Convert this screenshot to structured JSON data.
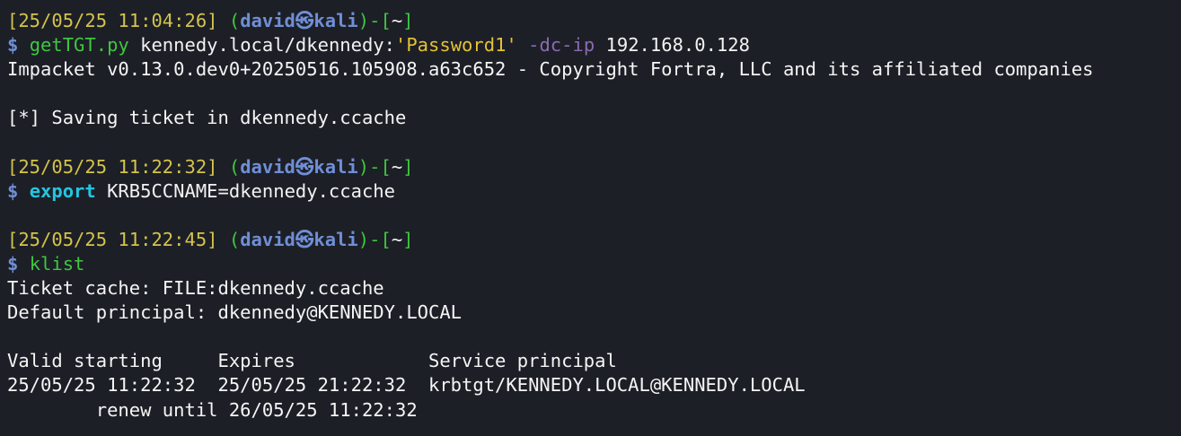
{
  "colors": {
    "background": "#1d1f27",
    "text": "#f2f2f2",
    "timestamp": "#d4c44a",
    "bracket": "#3ec73e",
    "user_host": "#6f8fd6",
    "command": "#3ec73e",
    "builtin": "#23c6e0",
    "string": "#e5c233",
    "option": "#8a6bb0"
  },
  "prompts": [
    {
      "timestamp": "[25/05/25 11:04:26]",
      "user": "david",
      "at_symbol": "㉿",
      "host": "kali",
      "dir": "~",
      "dollar": "$",
      "command": "getTGT.py",
      "arg1": "kennedy.local/dkennedy:",
      "arg_string": "'Password1'",
      "option": "-dc-ip",
      "arg2": "192.168.0.128"
    },
    {
      "timestamp": "[25/05/25 11:22:32]",
      "user": "david",
      "at_symbol": "㉿",
      "host": "kali",
      "dir": "~",
      "dollar": "$",
      "command": "export",
      "arg1": "KRB5CCNAME=dkennedy.ccache"
    },
    {
      "timestamp": "[25/05/25 11:22:45]",
      "user": "david",
      "at_symbol": "㉿",
      "host": "kali",
      "dir": "~",
      "dollar": "$",
      "command": "klist"
    }
  ],
  "output": {
    "impacket_banner": "Impacket v0.13.0.dev0+20250516.105908.a63c652 - Copyright Fortra, LLC and its affiliated companies",
    "saving_ticket": "[*] Saving ticket in dkennedy.ccache",
    "ticket_cache": "Ticket cache: FILE:dkennedy.ccache",
    "default_principal": "Default principal: dkennedy@KENNEDY.LOCAL",
    "table_header": "Valid starting     Expires            Service principal",
    "table_row": "25/05/25 11:22:32  25/05/25 21:22:32  krbtgt/KENNEDY.LOCAL@KENNEDY.LOCAL",
    "renew_until": "        renew until 26/05/25 11:22:32"
  }
}
